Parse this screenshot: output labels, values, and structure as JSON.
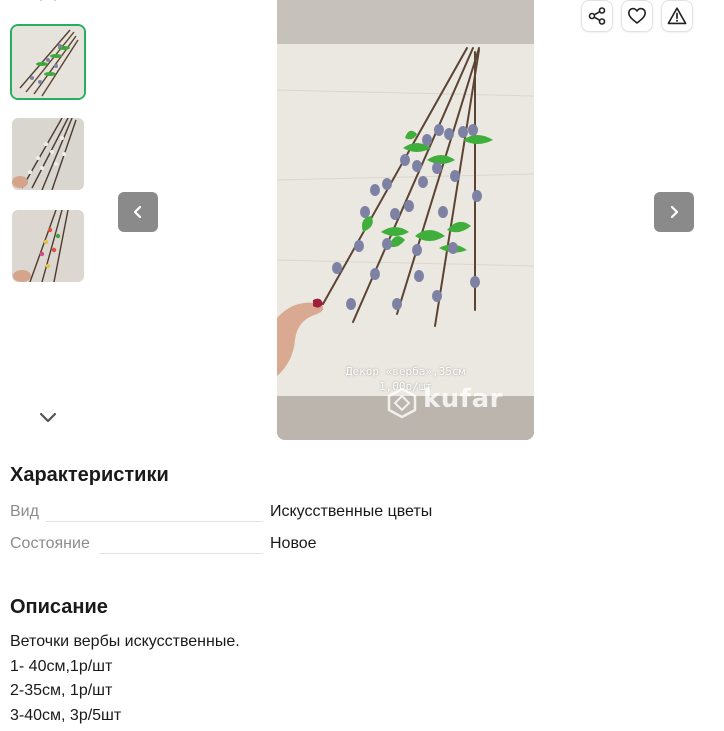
{
  "gallery": {
    "thumbnails": [
      {
        "alt": "thumbnail-1",
        "active": true
      },
      {
        "alt": "thumbnail-2",
        "active": false
      },
      {
        "alt": "thumbnail-3",
        "active": false
      }
    ]
  },
  "main_photo": {
    "caption_line1": "Декор «верба»,35см",
    "caption_line2": "1,00р/шт",
    "watermark": "kufar"
  },
  "specs": {
    "title": "Характеристики",
    "rows": [
      {
        "label": "Вид",
        "value": "Искусственные цветы"
      },
      {
        "label": "Состояние",
        "value": "Новое"
      }
    ]
  },
  "description": {
    "title": "Описание",
    "lines": [
      "Веточки вербы искусственные.",
      "1- 40см,1р/шт",
      "2-35см, 1р/шт",
      "3-40см, 3р/5шт"
    ]
  },
  "colors": {
    "accent": "#27ae60",
    "nav_button": "#8a8a8a",
    "label": "#8c8c8c"
  }
}
